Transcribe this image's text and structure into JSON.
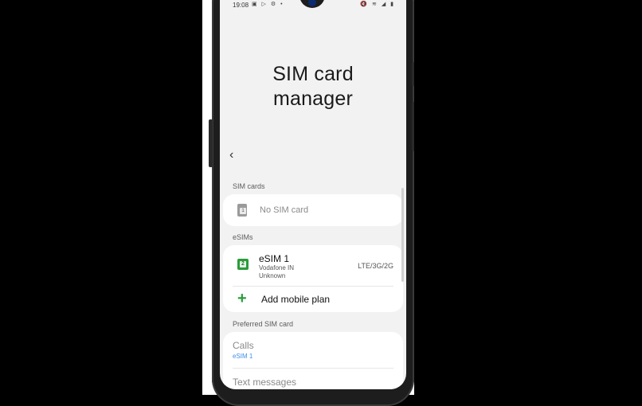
{
  "status_bar": {
    "time": "19:08",
    "left_icons": "▣ ▷ ⚙ •",
    "right_icons": "🔇 ≋ ◢ ▮"
  },
  "page": {
    "title_line1": "SIM card",
    "title_line2": "manager",
    "back_icon": "‹"
  },
  "sim_cards": {
    "section_label": "SIM cards",
    "items": [
      {
        "slot": "1",
        "label": "No SIM card"
      }
    ]
  },
  "esims": {
    "section_label": "eSIMs",
    "items": [
      {
        "slot": "2",
        "name": "eSIM 1",
        "carrier": "Vodafone IN",
        "number": "Unknown",
        "network": "LTE/3G/2G"
      }
    ],
    "add_plan_icon": "+",
    "add_plan_label": "Add mobile plan"
  },
  "preferred": {
    "section_label": "Preferred SIM card",
    "calls_label": "Calls",
    "calls_value": "eSIM 1",
    "text_label": "Text messages"
  },
  "colors": {
    "accent_green": "#2a9d3a",
    "link_blue": "#3e8ee8"
  }
}
